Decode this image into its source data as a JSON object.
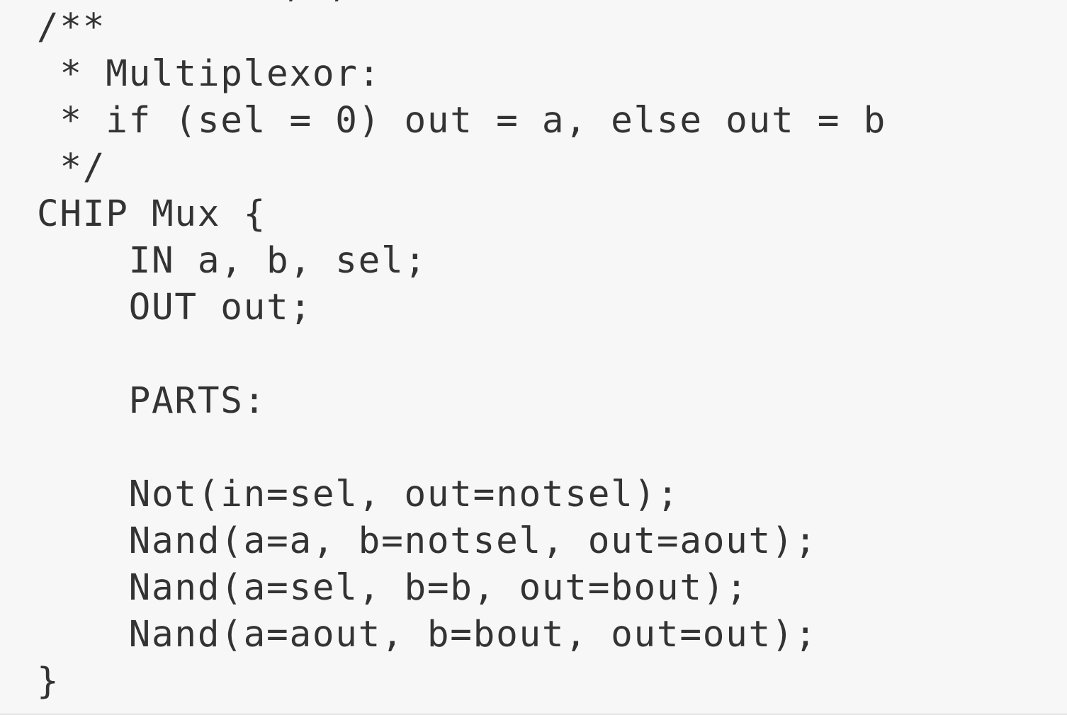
{
  "code": {
    "lines": [
      "/**",
      " * Multiplexor:",
      " * if (sel = 0) out = a, else out = b",
      " */",
      "CHIP Mux {",
      "    IN a, b, sel;",
      "    OUT out;",
      "",
      "    PARTS:",
      "",
      "    Not(in=sel, out=notsel);",
      "    Nand(a=a, b=notsel, out=aout);",
      "    Nand(a=sel, b=b, out=bout);",
      "    Nand(a=aout, b=bout, out=out);",
      "}"
    ]
  },
  "colors": {
    "background": "#f7f7f7",
    "text": "#333333"
  }
}
